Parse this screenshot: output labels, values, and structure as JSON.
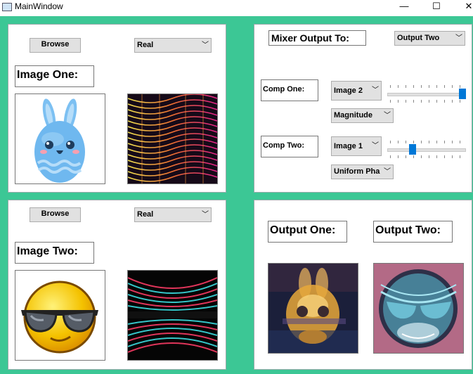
{
  "window": {
    "title": "MainWindow",
    "min_glyph": "—",
    "max_glyph": "☐",
    "close_glyph": "✕"
  },
  "image_one": {
    "browse_label": "Browse",
    "mode": "Real",
    "title": "Image One:"
  },
  "image_two": {
    "browse_label": "Browse",
    "mode": "Real",
    "title": "Image Two:"
  },
  "mixer": {
    "output_to_label": "Mixer Output To:",
    "output_to_value": "Output Two",
    "comp_one": {
      "label": "Comp One:",
      "image": "Image 2",
      "type": "Magnitude",
      "slider_value": 1.0
    },
    "comp_two": {
      "label": "Comp Two:",
      "image": "Image 1",
      "type": "Uniform Pha",
      "slider_value": 0.3
    }
  },
  "outputs": {
    "one_label": "Output One:",
    "two_label": "Output Two:"
  },
  "colors": {
    "background": "#3cc795",
    "slider_handle": "#0078d7"
  }
}
